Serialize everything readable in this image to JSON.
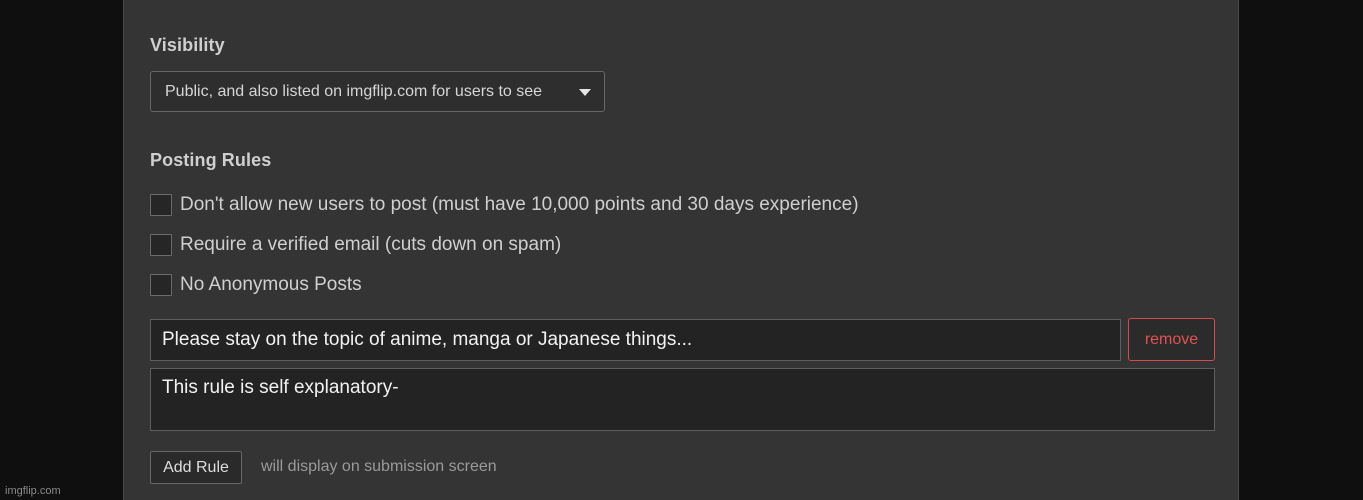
{
  "visibility": {
    "title": "Visibility",
    "selected": "Public, and also listed on imgflip.com for users to see"
  },
  "posting_rules": {
    "title": "Posting Rules",
    "options": [
      {
        "label": "Don't allow new users to post (must have 10,000 points and 30 days experience)",
        "checked": false
      },
      {
        "label": "Require a verified email (cuts down on spam)",
        "checked": false
      },
      {
        "label": "No Anonymous Posts",
        "checked": false
      }
    ]
  },
  "rule": {
    "title_value": "Please stay on the topic of anime, manga or Japanese things...",
    "description_value": "This rule is self explanatory-",
    "remove_label": "remove"
  },
  "add_rule": {
    "button_label": "Add Rule",
    "hint": "will display on submission screen"
  },
  "watermark": "imgflip.com",
  "colors": {
    "background": "#0f0f0f",
    "panel": "#343434",
    "remove_red": "#e05252"
  }
}
